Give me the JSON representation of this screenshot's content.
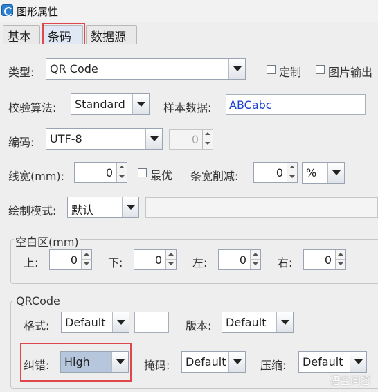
{
  "window": {
    "title": "图形属性"
  },
  "tabs": [
    {
      "label": "基本"
    },
    {
      "label": "条码",
      "active": true
    },
    {
      "label": "数据源"
    }
  ],
  "type_row": {
    "label": "类型:",
    "value": "QR Code",
    "custom_label": "定制",
    "image_output_label": "图片输出"
  },
  "check_row": {
    "label": "校验算法:",
    "value": "Standard",
    "sample_label": "样本数据:",
    "sample_value": "ABCabc"
  },
  "encoding_row": {
    "label": "编码:",
    "value": "UTF-8",
    "spin_value": "0"
  },
  "linewidth_row": {
    "label": "线宽(mm):",
    "value": "0",
    "optimal_label": "最优",
    "reduction_label": "条宽削减:",
    "reduction_value": "0",
    "unit_value": "%"
  },
  "draw_row": {
    "label": "绘制模式:",
    "value": "默认"
  },
  "quiet_zone": {
    "legend": "空白区(mm)",
    "top_label": "上:",
    "top_value": "0",
    "bottom_label": "下:",
    "bottom_value": "0",
    "left_label": "左:",
    "left_value": "0",
    "right_label": "右:",
    "right_value": "0"
  },
  "qrcode": {
    "legend": "QRCode",
    "format_label": "格式:",
    "format_value": "Default",
    "version_label": "版本:",
    "version_value": "Default",
    "ecc_label": "纠错:",
    "ecc_value": "High",
    "mask_label": "掩码:",
    "mask_value": "Default",
    "compress_label": "压缩:",
    "compress_value": "Default"
  },
  "watermark": "悟空问答",
  "colors": {
    "highlight": "#e0474c",
    "sample_text": "#1a3fd0"
  }
}
